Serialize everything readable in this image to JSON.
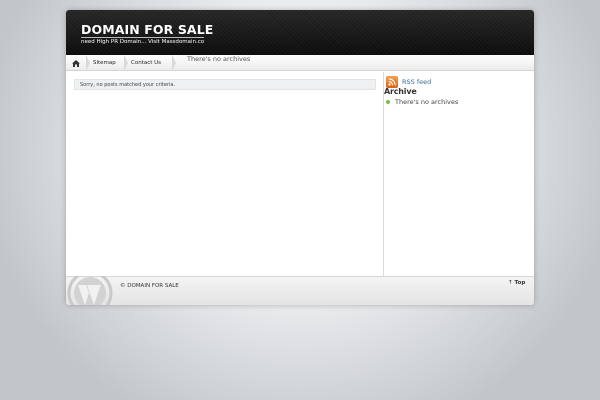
{
  "header": {
    "site_title": "DOMAIN FOR SALE",
    "tagline": "need High PR Domain... Visit Massdomain.co"
  },
  "nav": {
    "home_icon": "home-icon",
    "items": [
      {
        "label": "Sitemap"
      },
      {
        "label": "Contact Us"
      }
    ],
    "archive_title": "There's no archives"
  },
  "main": {
    "message": "Sorry, no posts matched your criteria."
  },
  "sidebar": {
    "rss_label": "RSS feed",
    "rss_icon": "rss-icon",
    "archive_heading": "Archive",
    "archive_item": "There's no archives"
  },
  "footer": {
    "copyright": "© DOMAIN FOR SALE",
    "top_link": "Top",
    "top_icon": "arrow-up-icon"
  },
  "colors": {
    "header_bg": "#111111",
    "link": "#3a6c98",
    "bullet": "#7bbf3a",
    "rss": "#e8782c"
  }
}
